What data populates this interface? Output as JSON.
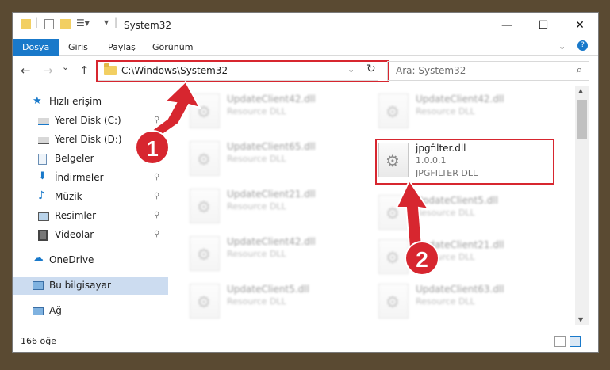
{
  "window": {
    "title": "System32",
    "minimize": "—",
    "maximize": "☐",
    "close": "✕"
  },
  "ribbon": {
    "tabs": [
      {
        "label": "Dosya"
      },
      {
        "label": "Giriş"
      },
      {
        "label": "Paylaş"
      },
      {
        "label": "Görünüm"
      }
    ]
  },
  "nav": {
    "back": "←",
    "forward": "→",
    "recent": "⌄",
    "up": "↑",
    "address": "C:\\Windows\\System32",
    "search_placeholder": "Ara: System32"
  },
  "sidebar": {
    "items": [
      {
        "label": "Hızlı erişim",
        "icon": "star-icon"
      },
      {
        "label": "Yerel Disk (C:)",
        "icon": "drive-icon"
      },
      {
        "label": "Yerel Disk (D:)",
        "icon": "drive-icon"
      },
      {
        "label": "Belgeler",
        "icon": "documents-icon"
      },
      {
        "label": "İndirmeler",
        "icon": "download-icon"
      },
      {
        "label": "Müzik",
        "icon": "music-icon"
      },
      {
        "label": "Resimler",
        "icon": "pictures-icon"
      },
      {
        "label": "Videolar",
        "icon": "video-icon"
      },
      {
        "label": "OneDrive",
        "icon": "cloud-icon"
      },
      {
        "label": "Bu bilgisayar",
        "icon": "computer-icon"
      },
      {
        "label": "Ağ",
        "icon": "network-icon"
      }
    ]
  },
  "files": {
    "left": [
      {
        "name": "UpdateClient42.dll",
        "type": "Resource DLL"
      },
      {
        "name": "UpdateClient65.dll",
        "type": "Resource DLL"
      },
      {
        "name": "UpdateClient21.dll",
        "type": "Resource DLL"
      },
      {
        "name": "UpdateClient42.dll",
        "type": "Resource DLL"
      },
      {
        "name": "UpdateClient5.dll",
        "type": "Resource DLL"
      }
    ],
    "right": [
      {
        "name": "UpdateClient42.dll",
        "type": "Resource DLL"
      },
      {
        "name": "UpdateClient5.dll",
        "type": "Resource DLL"
      },
      {
        "name": "UpdateClient21.dll",
        "type": "Resource DLL"
      },
      {
        "name": "UpdateClient63.dll",
        "type": "Resource DLL"
      }
    ],
    "selected": {
      "name": "jpgfilter.dll",
      "version": "1.0.0.1",
      "description": "JPGFILTER DLL"
    }
  },
  "status": {
    "count": "166 öğe"
  },
  "annotations": {
    "step1": "1",
    "step2": "2",
    "color": "#d7262f"
  }
}
